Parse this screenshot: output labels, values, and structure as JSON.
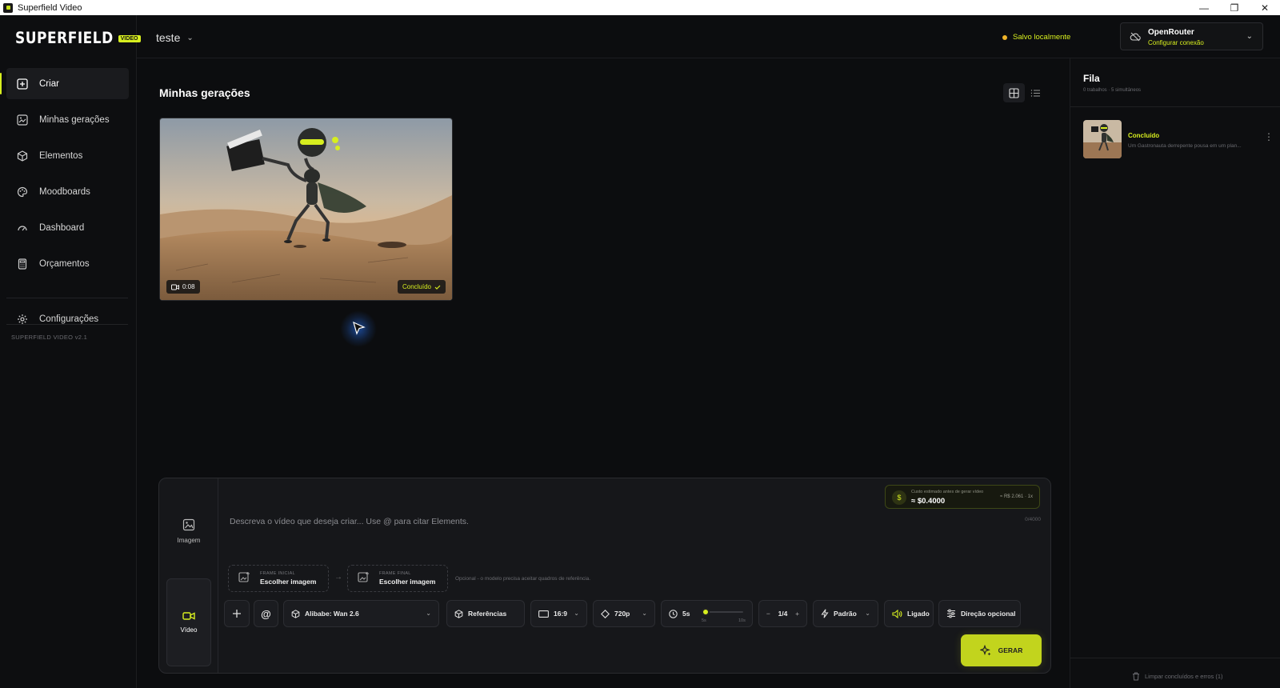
{
  "window": {
    "title": "Superfield Video",
    "controls": [
      "—",
      "❐",
      "✕"
    ]
  },
  "brand": {
    "name": "SUPERFIELD",
    "badge": "VIDEO",
    "accent": "#d7ee1f"
  },
  "sidebar": {
    "items": [
      {
        "label": "Criar",
        "icon": "plus-square-icon",
        "active": true
      },
      {
        "label": "Minhas gerações",
        "icon": "gallery-icon"
      },
      {
        "label": "Elementos",
        "icon": "cube-icon"
      },
      {
        "label": "Moodboards",
        "icon": "palette-icon"
      },
      {
        "label": "Dashboard",
        "icon": "gauge-icon"
      },
      {
        "label": "Orçamentos",
        "icon": "calculator-icon"
      }
    ],
    "settings_label": "Configurações",
    "version": "SUPERFIELD VIDEO v2.1"
  },
  "header": {
    "project": "teste",
    "saved_status": "Salvo localmente",
    "connection": {
      "name": "OpenRouter",
      "action": "Configurar conexão"
    }
  },
  "main": {
    "title": "Minhas gerações",
    "cards": [
      {
        "duration": "0:08",
        "status": "Concluído"
      }
    ]
  },
  "composer": {
    "modes": [
      {
        "label": "Imagem"
      },
      {
        "label": "Vídeo",
        "active": true
      }
    ],
    "placeholder": "Descreva o vídeo que deseja criar... Use @ para citar Elements.",
    "char_count": "0/4000",
    "cost": {
      "label": "Custo estimado antes de gerar vídeo",
      "value": "≈ $0.4000",
      "brl": "≈ R$ 2.061 · 1x"
    },
    "frame_start": {
      "kicker": "FRAME INICIAL",
      "value": "Escolher imagem"
    },
    "frame_arrow": "→",
    "frame_end": {
      "kicker": "FRAME FINAL",
      "value": "Escolher imagem"
    },
    "frame_note": "Opcional - o modelo precisa aceitar quadros de referência.",
    "model": "Alibabe: Wan 2.6",
    "references": "Referências",
    "aspect": "16:9",
    "resolution": "720p",
    "duration": {
      "value": "5s",
      "min": "5s",
      "max": "10s",
      "level_fraction": 0
    },
    "count": {
      "minus": "−",
      "value": "1/4",
      "plus": "+"
    },
    "style": "Padrão",
    "audio": "Ligado",
    "direction": "Direção opcional",
    "generate": "GERAR"
  },
  "queue": {
    "title": "Fila",
    "subtitle": "0 trabalhos · 5 simultâneos",
    "items": [
      {
        "status": "Concluído",
        "description": "Um Gastronauta derrepente pousa em um plan..."
      }
    ],
    "clear_label": "Limpar concluídos e erros (1)"
  }
}
